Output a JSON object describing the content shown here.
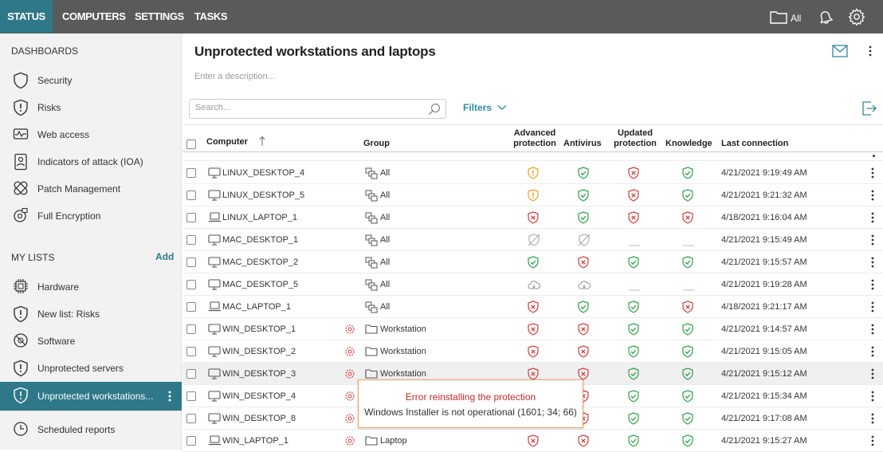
{
  "nav": {
    "tabs": [
      "STATUS",
      "COMPUTERS",
      "SETTINGS",
      "TASKS"
    ],
    "folder_label": "All"
  },
  "sidebar": {
    "dashboards_heading": "DASHBOARDS",
    "dashboards": [
      "Security",
      "Risks",
      "Web access",
      "Indicators of attack (IOA)",
      "Patch Management",
      "Full Encryption"
    ],
    "my_lists_heading": "MY LISTS",
    "add_label": "Add",
    "lists": [
      "Hardware",
      "New list: Risks",
      "Software",
      "Unprotected servers",
      "Unprotected workstations...",
      "Scheduled reports"
    ]
  },
  "main": {
    "title": "Unprotected workstations and laptops",
    "description_placeholder": "Enter a description...",
    "search_placeholder": "Search...",
    "filters_label": "Filters",
    "columns": {
      "computer": "Computer",
      "group": "Group",
      "advanced_line1": "Advanced",
      "advanced_line2": "protection",
      "antivirus": "Antivirus",
      "updated_line1": "Updated",
      "updated_line2": "protection",
      "knowledge": "Knowledge",
      "last_connection": "Last connection"
    },
    "rows": [
      {
        "computer": "LINUX_DESKTOP_4",
        "type": "desktop",
        "group": "All",
        "warn": false,
        "adv": "warn",
        "av": "ok",
        "upd": "err",
        "kn": "ok",
        "last": "4/21/2021 9:19:49 AM"
      },
      {
        "computer": "LINUX_DESKTOP_5",
        "type": "desktop",
        "group": "All",
        "warn": false,
        "adv": "warn",
        "av": "ok",
        "upd": "err",
        "kn": "ok",
        "last": "4/21/2021 9:21:32 AM"
      },
      {
        "computer": "LINUX_LAPTOP_1",
        "type": "laptop",
        "group": "All",
        "warn": false,
        "adv": "err",
        "av": "ok",
        "upd": "err",
        "kn": "err",
        "last": "4/18/2021 9:16:04 AM"
      },
      {
        "computer": "MAC_DESKTOP_1",
        "type": "desktop",
        "group": "All",
        "warn": false,
        "adv": "na",
        "av": "na",
        "upd": "dash",
        "kn": "dash",
        "last": "4/21/2021 9:15:49 AM"
      },
      {
        "computer": "MAC_DESKTOP_2",
        "type": "desktop",
        "group": "All",
        "warn": false,
        "adv": "ok",
        "av": "err",
        "upd": "ok",
        "kn": "ok",
        "last": "4/21/2021 9:15:57 AM"
      },
      {
        "computer": "MAC_DESKTOP_5",
        "type": "desktop",
        "group": "All",
        "warn": false,
        "adv": "cloud",
        "av": "cloud",
        "upd": "dash",
        "kn": "dash",
        "last": "4/21/2021 9:19:28 AM"
      },
      {
        "computer": "MAC_LAPTOP_1",
        "type": "laptop",
        "group": "All",
        "warn": false,
        "adv": "err",
        "av": "ok",
        "upd": "ok",
        "kn": "err",
        "last": "4/18/2021 9:21:17 AM"
      },
      {
        "computer": "WIN_DESKTOP_1",
        "type": "desktop",
        "group": "Workstation",
        "warn": true,
        "adv": "err",
        "av": "err",
        "upd": "ok",
        "kn": "ok",
        "last": "4/21/2021 9:14:57 AM"
      },
      {
        "computer": "WIN_DESKTOP_2",
        "type": "desktop",
        "group": "Workstation",
        "warn": true,
        "adv": "err",
        "av": "err",
        "upd": "ok",
        "kn": "ok",
        "last": "4/21/2021 9:15:05 AM"
      },
      {
        "computer": "WIN_DESKTOP_3",
        "type": "desktop",
        "group": "Workstation",
        "warn": true,
        "adv": "err",
        "av": "err",
        "upd": "ok",
        "kn": "ok",
        "last": "4/21/2021 9:15:12 AM"
      },
      {
        "computer": "WIN_DESKTOP_4",
        "type": "desktop",
        "group": "Workstation",
        "warn": true,
        "adv": "err",
        "av": "err",
        "upd": "ok",
        "kn": "ok",
        "last": "4/21/2021 9:15:34 AM"
      },
      {
        "computer": "WIN_DESKTOP_8",
        "type": "desktop",
        "group": "Workstation",
        "warn": true,
        "adv": "err",
        "av": "err",
        "upd": "ok",
        "kn": "ok",
        "last": "4/21/2021 9:17:08 AM"
      },
      {
        "computer": "WIN_LAPTOP_1",
        "type": "laptop",
        "group": "Laptop",
        "warn": true,
        "adv": "err",
        "av": "err",
        "upd": "ok",
        "kn": "ok",
        "last": "4/21/2021 9:15:27 AM"
      }
    ],
    "tooltip": {
      "title": "Error reinstalling the protection",
      "message": "Windows Installer is not operational (1601; 34; 66)"
    }
  },
  "colors": {
    "accent": "#2e7889",
    "ok": "#2e9e4a",
    "error": "#d23c3c",
    "warning": "#f0a020",
    "topbar": "#5a5a5a"
  }
}
